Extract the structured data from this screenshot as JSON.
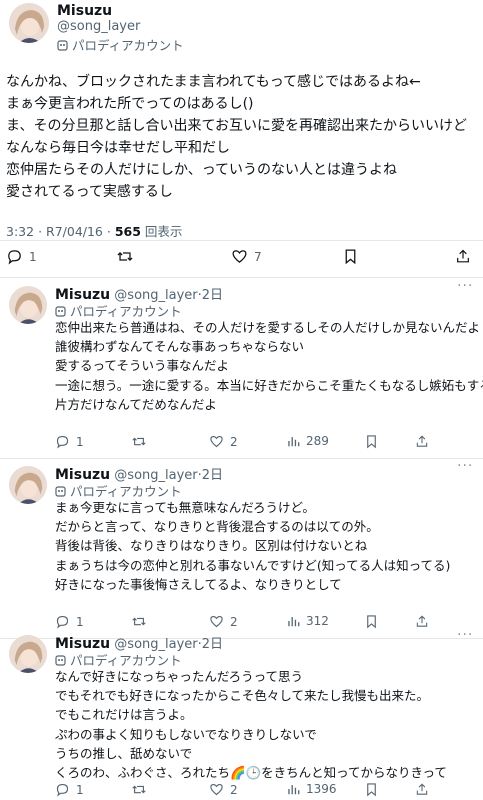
{
  "main_post": {
    "author_name": "Misuzu",
    "handle": "@song_layer",
    "parody_label": "パロディアカウント",
    "lines": [
      "なんかね、ブロックされたまま言われてもって感じではあるよね←",
      "まぁ今更言われた所でってのはあるし()",
      "ま、その分旦那と話し合い出来てお互いに愛を再確認出来たからいいけど",
      "なんなら毎日今は幸せだし平和だし",
      "恋仲居たらその人だけにしか、っていうのない人とは違うよね",
      "愛されてるって実感するし"
    ],
    "time": "3:32",
    "date": "R7/04/16",
    "views_count": "565",
    "views_label": "回表示",
    "replies": "1",
    "likes": "7"
  },
  "replies": [
    {
      "author_name": "Misuzu",
      "handle": "@song_layer",
      "age": "2日",
      "parody_label": "パロディアカウント",
      "lines": [
        "恋仲出来たら普通はね、その人だけを愛するしその人だけしか見ないんだよ",
        "誰彼構わずなんてそんな事あっちゃならない",
        "愛するってそういう事なんだよ",
        "一途に想う。一途に愛する。本当に好きだからこそ重たくもなるし嫉妬もする",
        "片方だけなんてだめなんだよ"
      ],
      "replies": "1",
      "likes": "2",
      "views": "289"
    },
    {
      "author_name": "Misuzu",
      "handle": "@song_layer",
      "age": "2日",
      "parody_label": "パロディアカウント",
      "lines": [
        "まぁ今更なに言っても無意味なんだろうけど。",
        "だからと言って、なりきりと背後混合するのは以ての外。",
        "背後は背後、なりきりはなりきり。区別は付けないとね",
        "まぁうちは今の恋仲と別れる事ないんですけど(知ってる人は知ってる)",
        "好きになった事後悔さえしてるよ、なりきりとして"
      ],
      "replies": "1",
      "likes": "2",
      "views": "312"
    },
    {
      "author_name": "Misuzu",
      "handle": "@song_layer",
      "age": "2日",
      "parody_label": "パロディアカウント",
      "lines": [
        "なんで好きになっちゃったんだろうって思う",
        "でもそれでも好きになったからこそ色々して来たし我慢も出来た。",
        "でもこれだけは言うよ。",
        "ぷわの事よく知りもしないでなりきりしないで",
        "うちの推し、舐めないで",
        "くろのわ、ふわぐさ、ろれたち🌈🕒をきちんと知ってからなりきって"
      ],
      "replies": "1",
      "likes": "2",
      "views": "1396"
    }
  ],
  "icons": [
    "parody-mask-icon",
    "reply-icon",
    "repost-icon",
    "like-icon",
    "bookmark-icon",
    "share-icon",
    "views-icon",
    "more-icon"
  ],
  "colors": {
    "text": "#0f1419",
    "muted": "#536471",
    "divider": "#e6e6e6"
  }
}
